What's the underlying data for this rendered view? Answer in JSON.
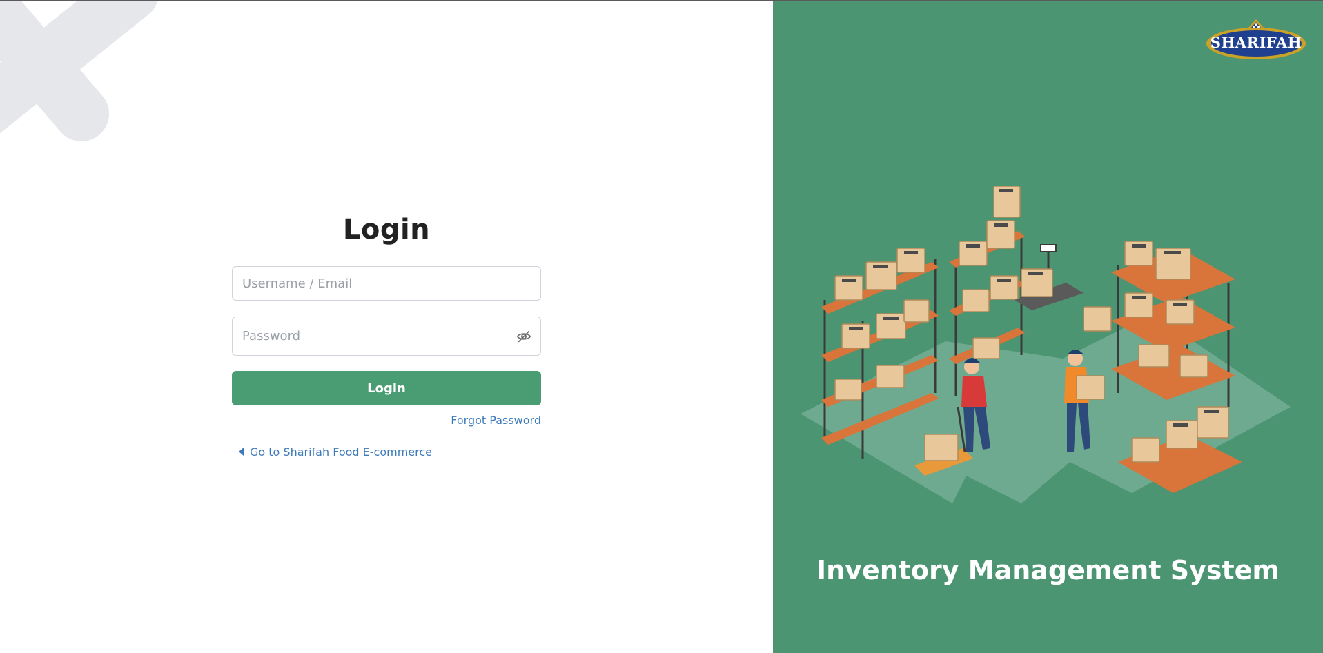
{
  "login": {
    "title": "Login",
    "username_placeholder": "Username / Email",
    "password_placeholder": "Password",
    "submit_label": "Login",
    "forgot_password_label": "Forgot Password",
    "back_link_label": "Go to Sharifah Food E-commerce"
  },
  "brand": {
    "logo_text": "SHARIFAH"
  },
  "hero": {
    "caption": "Inventory Management System"
  },
  "icons": {
    "password_toggle": "eye-slash-icon",
    "back": "caret-left-icon"
  },
  "colors": {
    "primary_green": "#4a9c72",
    "panel_green": "#4c9572",
    "link_blue": "#3d7ab8",
    "decoration_gray": "#e6e7ea",
    "shelf_orange": "#d9743a",
    "box_tan": "#e8c79a",
    "logo_navy": "#1f3f8f",
    "logo_gold": "#c9a227"
  }
}
